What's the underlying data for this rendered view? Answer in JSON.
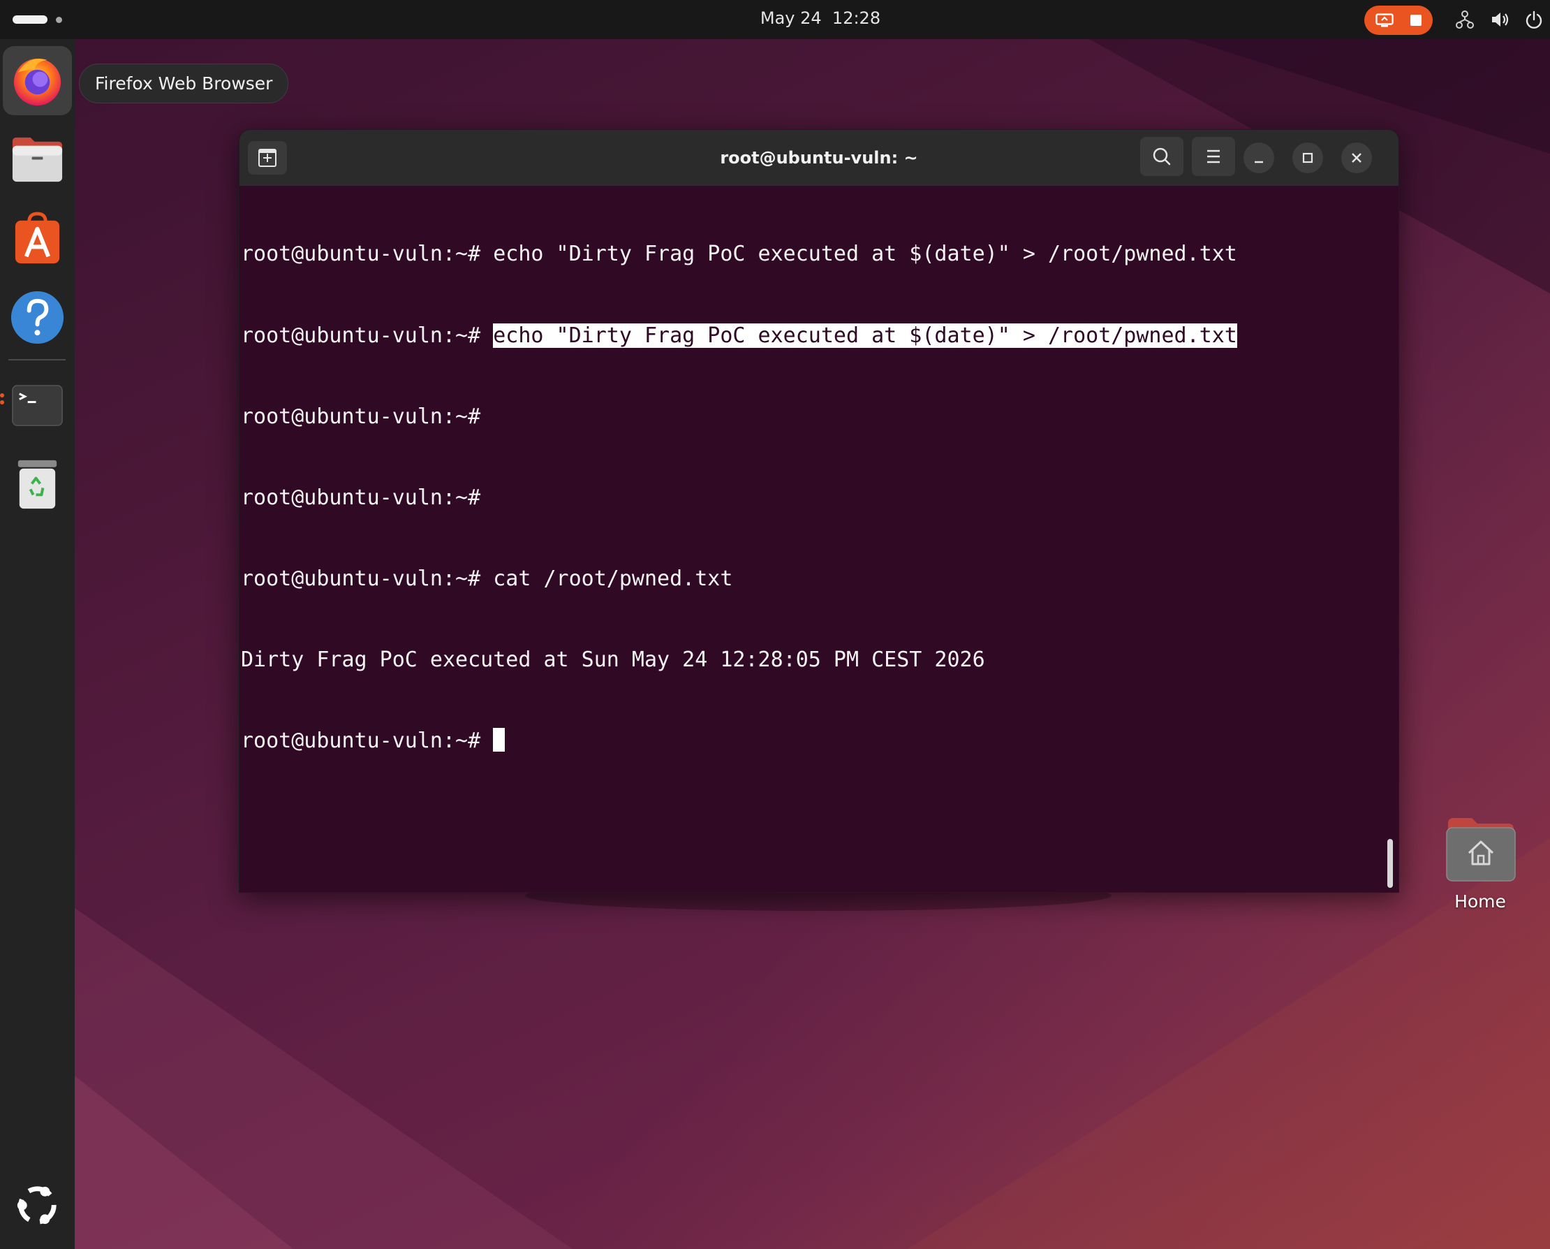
{
  "topbar": {
    "clock": "May 24  12:28",
    "tray_icons": [
      "screen-share-icon",
      "stop-recording-icon",
      "network-icon",
      "volume-icon",
      "power-icon"
    ]
  },
  "dock": {
    "items": [
      {
        "name": "firefox",
        "icon": "firefox-icon",
        "active": true
      },
      {
        "name": "files",
        "icon": "files-icon"
      },
      {
        "name": "app-center",
        "icon": "app-center-icon"
      },
      {
        "name": "help",
        "icon": "help-icon"
      },
      {
        "name": "terminal",
        "icon": "terminal-icon",
        "running": true
      },
      {
        "name": "trash",
        "icon": "trash-icon"
      },
      {
        "name": "show-apps",
        "icon": "ubuntu-logo-icon"
      }
    ],
    "tooltip": "Firefox Web Browser"
  },
  "terminal": {
    "title": "root@ubuntu-vuln: ~",
    "prompt": "root@ubuntu-vuln:~# ",
    "lines": [
      {
        "prompt": "root@ubuntu-vuln:~# ",
        "text": "echo \"Dirty Frag PoC executed at $(date)\" > /root/pwned.txt"
      },
      {
        "prompt": "root@ubuntu-vuln:~# ",
        "selected": "echo \"Dirty Frag PoC executed at $(date)\" > /root/pwned.txt"
      },
      {
        "prompt": "root@ubuntu-vuln:~#",
        "text": ""
      },
      {
        "prompt": "root@ubuntu-vuln:~#",
        "text": ""
      },
      {
        "prompt": "root@ubuntu-vuln:~# ",
        "text": "cat /root/pwned.txt"
      },
      {
        "prompt": "",
        "text": "Dirty Frag PoC executed at Sun May 24 12:28:05 PM CEST 2026"
      },
      {
        "prompt": "root@ubuntu-vuln:~# ",
        "text": ""
      }
    ]
  },
  "desktop": {
    "home_label": "Home"
  },
  "colors": {
    "accent": "#e95420",
    "terminal_bg": "#300a24",
    "titlebar_bg": "#2b2b2b",
    "topbar_bg": "#181818",
    "dock_bg": "#232323"
  }
}
